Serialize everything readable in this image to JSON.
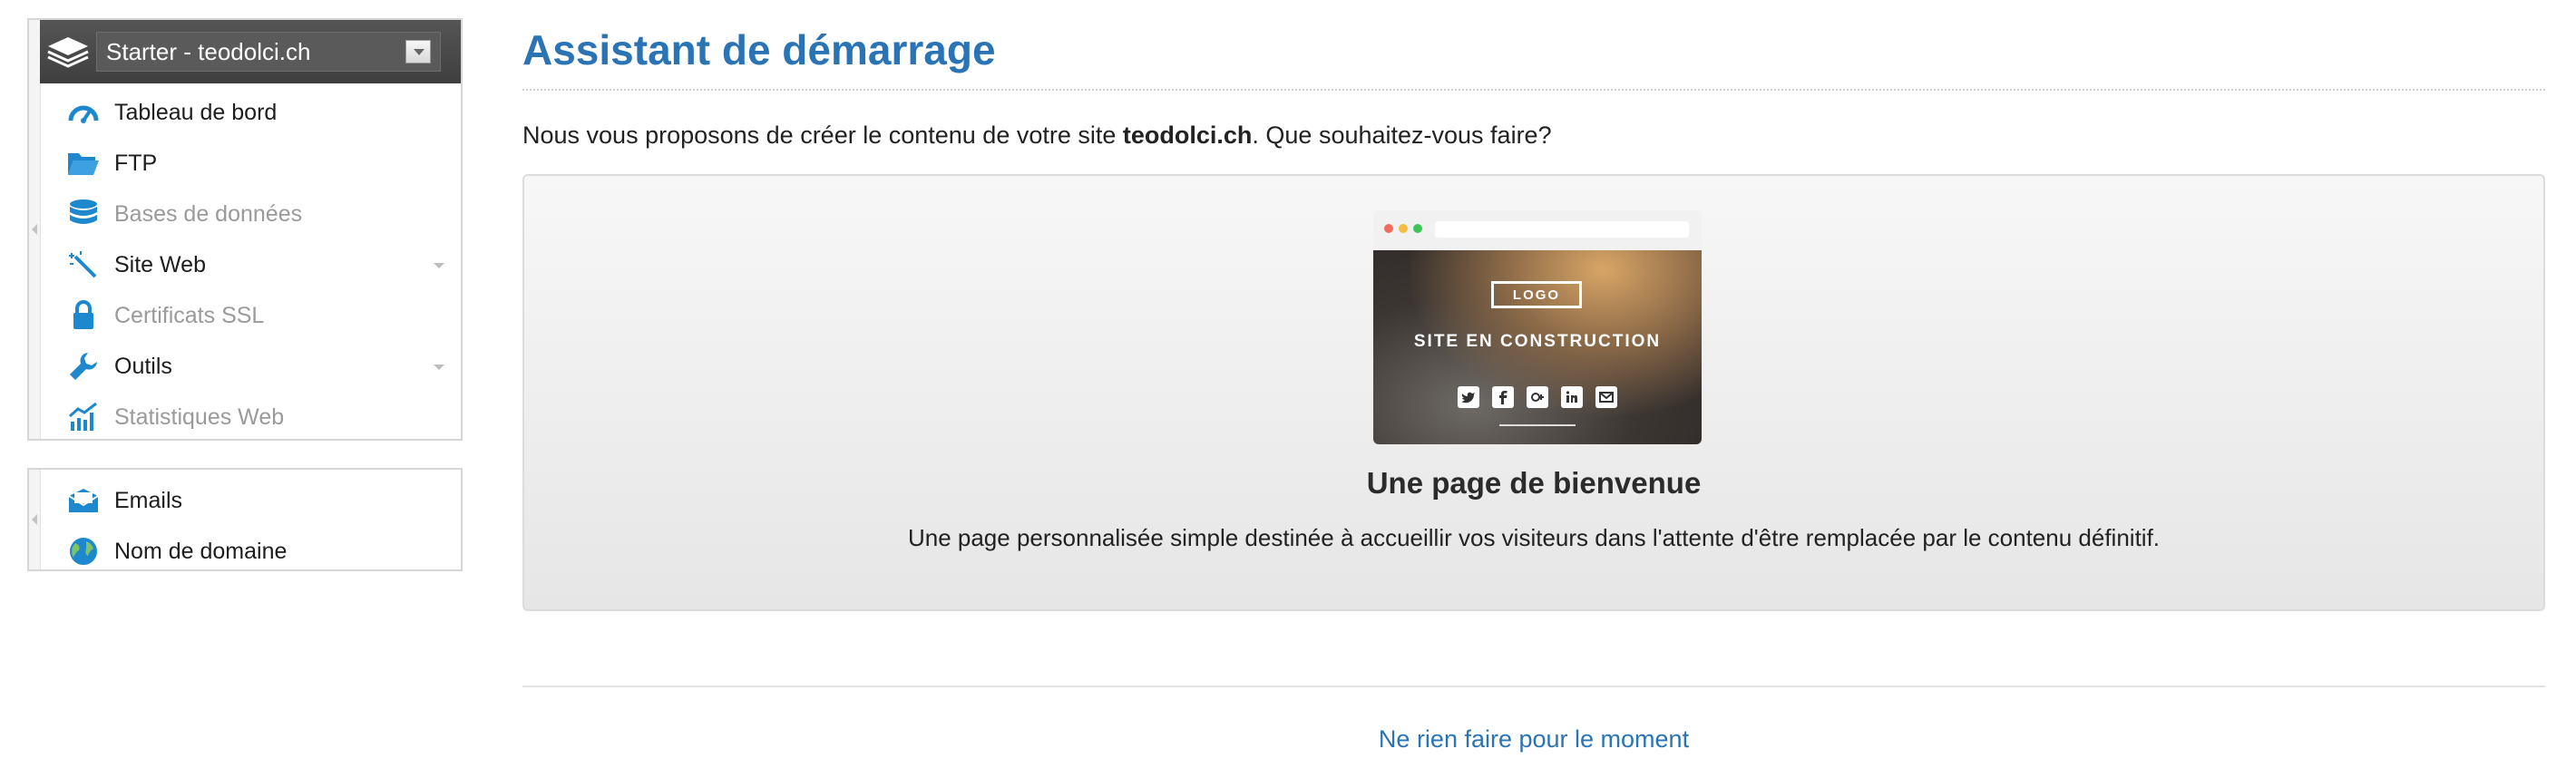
{
  "sidebar": {
    "plan_selector": {
      "label": "Starter - teodolci.ch"
    },
    "menu": [
      {
        "label": "Tableau de bord",
        "icon": "dashboard-gauge-icon",
        "enabled": true,
        "submenu": false
      },
      {
        "label": "FTP",
        "icon": "folder-open-icon",
        "enabled": true,
        "submenu": false
      },
      {
        "label": "Bases de données",
        "icon": "database-icon",
        "enabled": false,
        "submenu": false
      },
      {
        "label": "Site Web",
        "icon": "magic-wand-icon",
        "enabled": true,
        "submenu": true
      },
      {
        "label": "Certificats SSL",
        "icon": "lock-icon",
        "enabled": false,
        "submenu": false
      },
      {
        "label": "Outils",
        "icon": "wrench-icon",
        "enabled": true,
        "submenu": true
      },
      {
        "label": "Statistiques Web",
        "icon": "statistics-chart-icon",
        "enabled": false,
        "submenu": false
      }
    ],
    "menu2": [
      {
        "label": "Emails",
        "icon": "envelope-icon",
        "enabled": true
      },
      {
        "label": "Nom de domaine",
        "icon": "globe-icon",
        "enabled": true
      }
    ]
  },
  "main": {
    "title": "Assistant de démarrage",
    "intro_prefix": "Nous vous proposons de créer le contenu de votre site ",
    "intro_site": "teodolci.ch",
    "intro_suffix": ". Que souhaitez-vous faire?",
    "option": {
      "thumbnail": {
        "logo": "LOGO",
        "headline": "SITE EN CONSTRUCTION",
        "social_icons": [
          "twitter-icon",
          "facebook-icon",
          "google-plus-icon",
          "linkedin-icon",
          "mail-icon"
        ]
      },
      "title": "Une page de bienvenue",
      "description": "Une page personnalisée simple destinée à accueillir vos visiteurs dans l'attente d'être remplacée par le contenu définitif."
    },
    "skip_link": "Ne rien faire pour le moment"
  },
  "colors": {
    "accent": "#2a74b5",
    "icon_blue": "#1e88cf",
    "header_dark": "#4a4a4a",
    "disabled_text": "#9a9a9a"
  }
}
